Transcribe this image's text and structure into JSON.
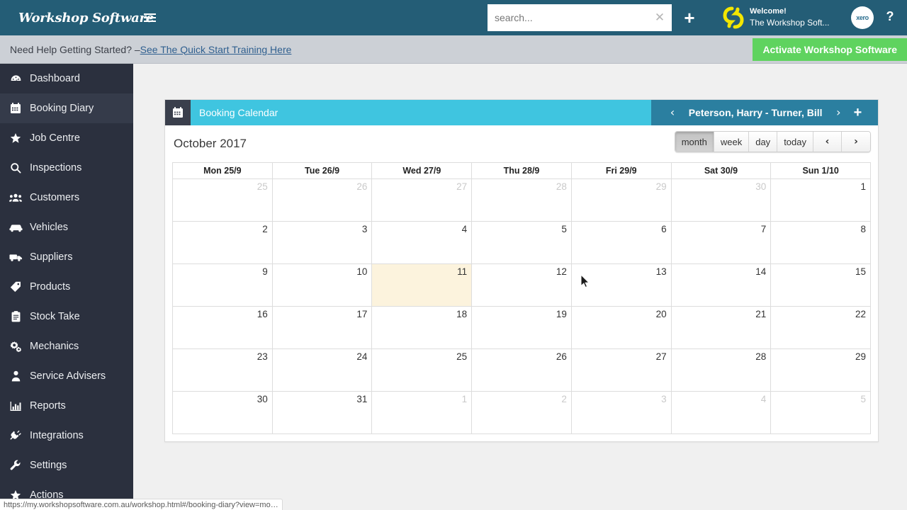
{
  "topnav": {
    "brand": "Workshop Software",
    "menu_icon": "hamburger-icon",
    "search": {
      "placeholder": "search...",
      "value": "",
      "clear_glyph": "✕"
    },
    "add_glyph": "+",
    "welcome_line1": "Welcome!",
    "welcome_line2": "The Workshop Soft...",
    "xero_label": "xero",
    "help_glyph": "?",
    "bg_color": "#245d76"
  },
  "notice": {
    "text": "Need Help Getting Started? – ",
    "link": "See The Quick Start Training Here",
    "activate_label": "Activate Workshop Software",
    "activate_color": "#5fd35f",
    "bg_color": "#ccd0d6"
  },
  "sidebar": {
    "active_index": 1,
    "bg_color": "#2b303e",
    "items": [
      {
        "label": "Dashboard",
        "icon": "gauge-icon"
      },
      {
        "label": "Booking Diary",
        "icon": "calendar-icon"
      },
      {
        "label": "Job Centre",
        "icon": "star-icon"
      },
      {
        "label": "Inspections",
        "icon": "search-icon"
      },
      {
        "label": "Customers",
        "icon": "users-icon"
      },
      {
        "label": "Vehicles",
        "icon": "car-icon"
      },
      {
        "label": "Suppliers",
        "icon": "truck-icon"
      },
      {
        "label": "Products",
        "icon": "tag-icon"
      },
      {
        "label": "Stock Take",
        "icon": "clipboard-icon"
      },
      {
        "label": "Mechanics",
        "icon": "gears-icon"
      },
      {
        "label": "Service Advisers",
        "icon": "person-icon"
      },
      {
        "label": "Reports",
        "icon": "bar-chart-icon"
      },
      {
        "label": "Integrations",
        "icon": "plug-icon"
      },
      {
        "label": "Settings",
        "icon": "wrench-icon"
      },
      {
        "label": "Actions",
        "icon": "star-icon"
      }
    ]
  },
  "panel": {
    "icon": "calendar-icon",
    "title": "Booking Calendar",
    "resource_prev_glyph": "‹",
    "resource_name": "Peterson, Harry - Turner, Bill",
    "resource_next_glyph": "›",
    "resource_add_glyph": "+",
    "title_bg": "#3fc5e0",
    "right_bg": "#2b7fa0"
  },
  "calendar": {
    "title": "October 2017",
    "views": [
      {
        "label": "month",
        "active": true
      },
      {
        "label": "week",
        "active": false
      },
      {
        "label": "day",
        "active": false
      },
      {
        "label": "today",
        "active": false
      }
    ],
    "prev_glyph": "‹",
    "next_glyph": "›",
    "today_color": "#fcf3dd",
    "headers": [
      "Mon 25/9",
      "Tue 26/9",
      "Wed 27/9",
      "Thu 28/9",
      "Fri 29/9",
      "Sat 30/9",
      "Sun 1/10"
    ],
    "weeks": [
      [
        {
          "day": "25",
          "other": true,
          "today": false
        },
        {
          "day": "26",
          "other": true,
          "today": false
        },
        {
          "day": "27",
          "other": true,
          "today": false
        },
        {
          "day": "28",
          "other": true,
          "today": false
        },
        {
          "day": "29",
          "other": true,
          "today": false
        },
        {
          "day": "30",
          "other": true,
          "today": false
        },
        {
          "day": "1",
          "other": false,
          "today": false
        }
      ],
      [
        {
          "day": "2",
          "other": false,
          "today": false
        },
        {
          "day": "3",
          "other": false,
          "today": false
        },
        {
          "day": "4",
          "other": false,
          "today": false
        },
        {
          "day": "5",
          "other": false,
          "today": false
        },
        {
          "day": "6",
          "other": false,
          "today": false
        },
        {
          "day": "7",
          "other": false,
          "today": false
        },
        {
          "day": "8",
          "other": false,
          "today": false
        }
      ],
      [
        {
          "day": "9",
          "other": false,
          "today": false
        },
        {
          "day": "10",
          "other": false,
          "today": false
        },
        {
          "day": "11",
          "other": false,
          "today": true
        },
        {
          "day": "12",
          "other": false,
          "today": false
        },
        {
          "day": "13",
          "other": false,
          "today": false
        },
        {
          "day": "14",
          "other": false,
          "today": false
        },
        {
          "day": "15",
          "other": false,
          "today": false
        }
      ],
      [
        {
          "day": "16",
          "other": false,
          "today": false
        },
        {
          "day": "17",
          "other": false,
          "today": false
        },
        {
          "day": "18",
          "other": false,
          "today": false
        },
        {
          "day": "19",
          "other": false,
          "today": false
        },
        {
          "day": "20",
          "other": false,
          "today": false
        },
        {
          "day": "21",
          "other": false,
          "today": false
        },
        {
          "day": "22",
          "other": false,
          "today": false
        }
      ],
      [
        {
          "day": "23",
          "other": false,
          "today": false
        },
        {
          "day": "24",
          "other": false,
          "today": false
        },
        {
          "day": "25",
          "other": false,
          "today": false
        },
        {
          "day": "26",
          "other": false,
          "today": false
        },
        {
          "day": "27",
          "other": false,
          "today": false
        },
        {
          "day": "28",
          "other": false,
          "today": false
        },
        {
          "day": "29",
          "other": false,
          "today": false
        }
      ],
      [
        {
          "day": "30",
          "other": false,
          "today": false
        },
        {
          "day": "31",
          "other": false,
          "today": false
        },
        {
          "day": "1",
          "other": true,
          "today": false
        },
        {
          "day": "2",
          "other": true,
          "today": false
        },
        {
          "day": "3",
          "other": true,
          "today": false
        },
        {
          "day": "4",
          "other": true,
          "today": false
        },
        {
          "day": "5",
          "other": true,
          "today": false
        }
      ]
    ]
  },
  "statusbar": {
    "url": "https://my.workshopsoftware.com.au/workshop.html#/booking-diary?view=mo…"
  }
}
